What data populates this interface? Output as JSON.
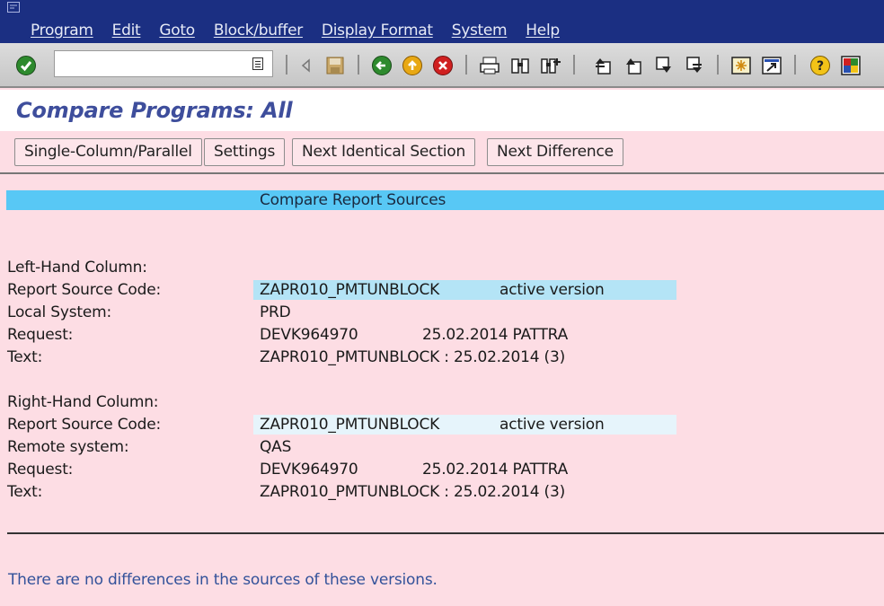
{
  "menubar": {
    "items": [
      "Program",
      "Edit",
      "Goto",
      "Block/buffer",
      "Display Format",
      "System",
      "Help"
    ]
  },
  "toolbar": {
    "command_value": "",
    "icons": [
      "enter-icon",
      "back-icon",
      "save-icon",
      "green-back-icon",
      "exit-icon",
      "cancel-icon",
      "print-icon",
      "find-icon",
      "find-next-icon",
      "first-page-icon",
      "previous-page-icon",
      "next-page-icon",
      "last-page-icon",
      "new-session-icon",
      "shortcut-icon",
      "help-icon",
      "customize-layout-icon"
    ]
  },
  "title": "Compare Programs: All",
  "app_toolbar": {
    "buttons": [
      "Single-Column/Parallel",
      "Settings",
      "Next Identical Section",
      "Next Difference"
    ]
  },
  "content": {
    "header": "Compare Report Sources",
    "left": {
      "section_label": "Left-Hand Column:",
      "source_label": "Report Source Code:",
      "source_name": "ZAPR010_PMTUNBLOCK",
      "source_version": "active version",
      "system_label": "Local System:",
      "system_value": "PRD",
      "request_label": "Request:",
      "request_id": "DEVK964970",
      "request_info": "25.02.2014 PATTRA",
      "text_label": "Text:",
      "text_value": "ZAPR010_PMTUNBLOCK : 25.02.2014 (3)"
    },
    "right": {
      "section_label": "Right-Hand Column:",
      "source_label": "Report Source Code:",
      "source_name": "ZAPR010_PMTUNBLOCK",
      "source_version": "active version",
      "system_label": "Remote system:",
      "system_value": "QAS",
      "request_label": "Request:",
      "request_id": "DEVK964970",
      "request_info": "25.02.2014 PATTRA",
      "text_label": "Text:",
      "text_value": "ZAPR010_PMTUNBLOCK : 25.02.2014 (3)"
    },
    "message": "There are no differences in the sources of these versions."
  },
  "colors": {
    "menubar": "#1b2f82",
    "background": "#fddde4",
    "header_strip": "#58c8f5",
    "title": "#3e4e9c",
    "message": "#33529a"
  }
}
